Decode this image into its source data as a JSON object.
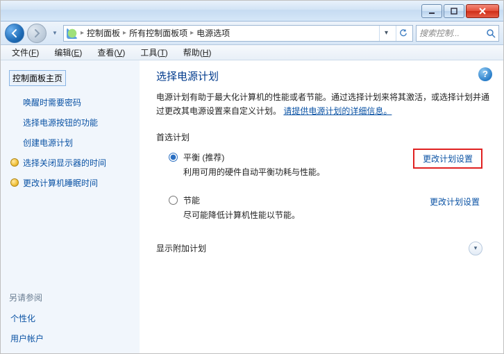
{
  "window_controls": {
    "min": "min",
    "max": "max",
    "close": "close"
  },
  "breadcrumbs": [
    "控制面板",
    "所有控制面板项",
    "电源选项"
  ],
  "search_placeholder": "搜索控制...",
  "menu": {
    "file": {
      "label": "文件",
      "key": "F"
    },
    "edit": {
      "label": "编辑",
      "key": "E"
    },
    "view": {
      "label": "查看",
      "key": "V"
    },
    "tools": {
      "label": "工具",
      "key": "T"
    },
    "help": {
      "label": "帮助",
      "key": "H"
    }
  },
  "sidebar": {
    "home": "控制面板主页",
    "links": [
      "唤醒时需要密码",
      "选择电源按钮的功能",
      "创建电源计划",
      "选择关闭显示器的时间",
      "更改计算机睡眠时间"
    ],
    "see_also": "另请参阅",
    "footer": [
      "个性化",
      "用户帐户"
    ]
  },
  "main": {
    "title": "选择电源计划",
    "desc_part1": "电源计划有助于最大化计算机的性能或者节能。通过选择计划来将其激活，或选择计划并通过更改其电源设置来自定义计划。",
    "desc_link": "请提供电源计划的详细信息。",
    "preferred_label": "首选计划",
    "plans": [
      {
        "name": "平衡 (推荐)",
        "desc": "利用可用的硬件自动平衡功耗与性能。",
        "action": "更改计划设置",
        "checked": true,
        "highlight": true
      },
      {
        "name": "节能",
        "desc": "尽可能降低计算机性能以节能。",
        "action": "更改计划设置",
        "checked": false,
        "highlight": false
      }
    ],
    "extra_label": "显示附加计划"
  }
}
